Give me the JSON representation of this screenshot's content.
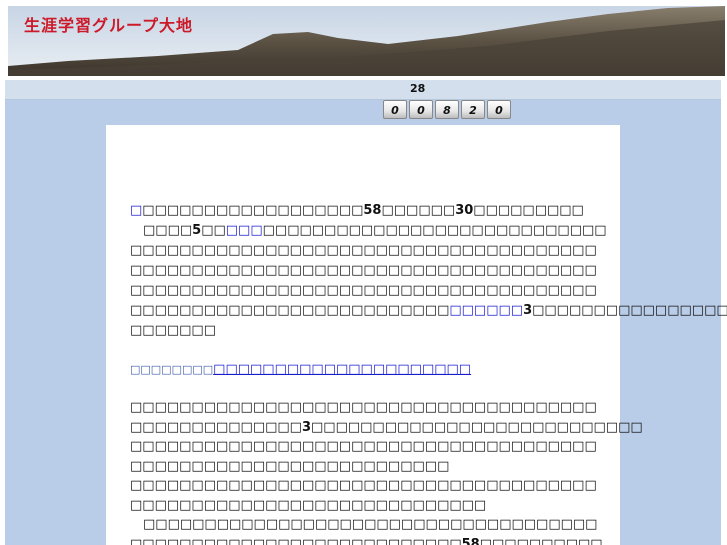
{
  "header": {
    "site_title": "生涯学習グループ大地"
  },
  "counter": {
    "number": "28",
    "digits": [
      "0",
      "0",
      "8",
      "2",
      "0"
    ]
  },
  "content": {
    "paragraph1": [
      {
        "parts": [
          {
            "t": "□",
            "c": "link"
          },
          {
            "t": "□□□□□□□□□□□□□□□□□□"
          },
          {
            "t": "58",
            "c": "b"
          },
          {
            "t": "□□□□□□"
          },
          {
            "t": "30",
            "c": "b"
          },
          {
            "t": "□□□□□□□□□"
          }
        ]
      },
      {
        "parts": [
          {
            "t": "　□□□□"
          },
          {
            "t": "5",
            "c": "b"
          },
          {
            "t": "□□"
          },
          {
            "t": "□□□",
            "c": "link"
          },
          {
            "t": "□□□□□□□□□□□□□□□□□□□□□□□□□□□□"
          }
        ]
      },
      {
        "parts": [
          {
            "t": "□□□□□□□□□□□□□□□□□□□□□□□□□□□□□□□□□□□□□□"
          }
        ]
      },
      {
        "parts": [
          {
            "t": "□□□□□□□□□□□□□□□□□□□□□□□□□□□□□□□□□□□□□□"
          }
        ]
      },
      {
        "parts": [
          {
            "t": "□□□□□□□□□□□□□□□□□□□□□□□□□□□□□□□□□□□□□□"
          }
        ]
      },
      {
        "parts": [
          {
            "t": "□□□□□□□□□□□□□□□□□□□□□□□□□□"
          },
          {
            "t": "□□□□□□",
            "c": "link"
          },
          {
            "t": "3",
            "c": "b"
          },
          {
            "t": "□□□□□□□□□□□□□□□□"
          }
        ]
      },
      {
        "parts": [
          {
            "t": "□□□□□□□"
          }
        ]
      }
    ],
    "link_row": {
      "small": "□□□□□□□□",
      "big": "□□□□□□□□□□□□□□□□□□□□□"
    },
    "paragraph2": [
      {
        "parts": [
          {
            "t": "□□□□□□□□□□□□□□□□□□□□□□□□□□□□□□□□□□□□□□"
          }
        ]
      },
      {
        "parts": [
          {
            "t": "□□□□□□□□□□□□□□"
          },
          {
            "t": "3",
            "c": "b"
          },
          {
            "t": "□□□□□□□□□□□□□□□□□□□□□□□□□□□"
          }
        ]
      },
      {
        "parts": [
          {
            "t": "□□□□□□□□□□□□□□□□□□□□□□□□□□□□□□□□□□□□□□"
          }
        ]
      },
      {
        "parts": [
          {
            "t": "□□□□□□□□□□□□□□□□□□□□□□□□□□"
          }
        ]
      },
      {
        "parts": [
          {
            "t": "□□□□□□□□□□□□□□□□□□□□□□□□□□□□□□□□□□□□□□"
          }
        ]
      },
      {
        "parts": [
          {
            "t": "□□□□□□□□□□□□□□□□□□□□□□□□□□□□□"
          }
        ]
      },
      {
        "parts": [
          {
            "t": "　□□□□□□□□□□□□□□□□□□□□□□□□□□□□□□□□□□□□□"
          }
        ]
      },
      {
        "parts": [
          {
            "t": "□□□□□□□□□□□□□□□□□□□□□□□□□□□"
          },
          {
            "t": "58",
            "c": "b"
          },
          {
            "t": "□□□□□□□□□□"
          }
        ]
      }
    ]
  }
}
